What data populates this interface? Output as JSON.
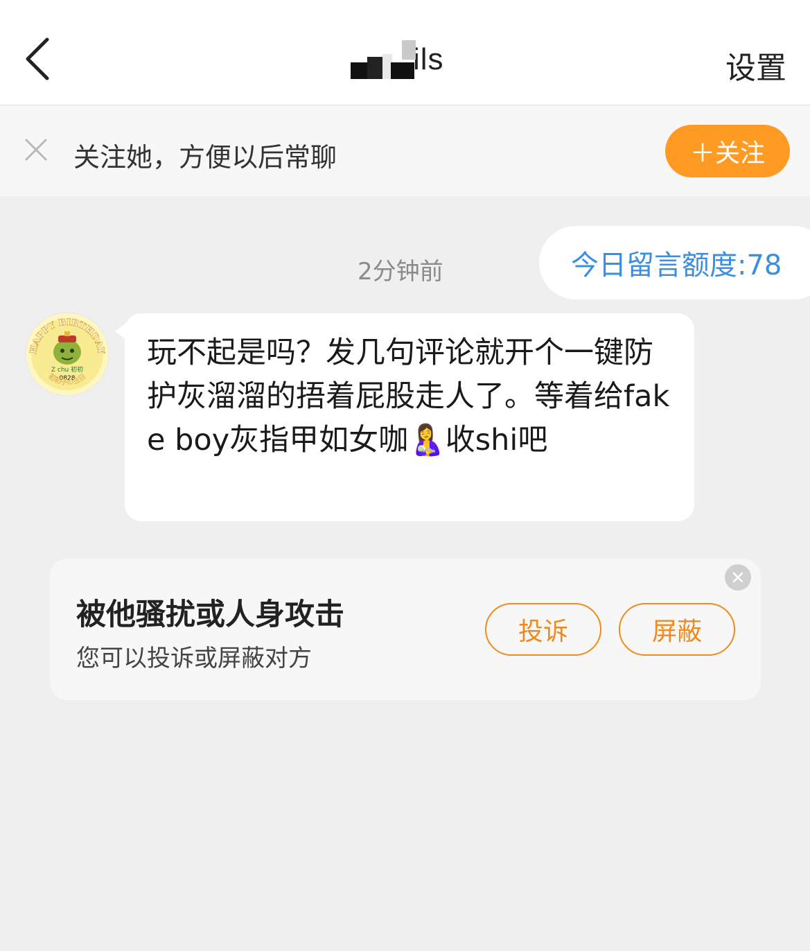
{
  "header": {
    "title": "ils",
    "settings_label": "设置"
  },
  "follow_bar": {
    "text": "关注她，方便以后常聊",
    "button_label": "＋关注"
  },
  "chat": {
    "timestamp": "2分钟前",
    "quota_text": "今日留言额度:78",
    "message": "玩不起是吗？发几句评论就开个一键防护灰溜溜的捂着屁股走人了。等着给fake boy灰指甲如女咖🤱收shi吧",
    "avatar": {
      "ring_text": "HAPPY BIRTHDAY",
      "inner_text": "Z chu 初初",
      "date_text": "0828",
      "bottom_text": "初初子の生日"
    }
  },
  "report_card": {
    "title": "被他骚扰或人身攻击",
    "subtitle": "您可以投诉或屏蔽对方",
    "report_label": "投诉",
    "block_label": "屏蔽"
  },
  "colors": {
    "accent_orange": "#ff9a22",
    "link_blue": "#3c8fe0",
    "background": "#efefef"
  }
}
